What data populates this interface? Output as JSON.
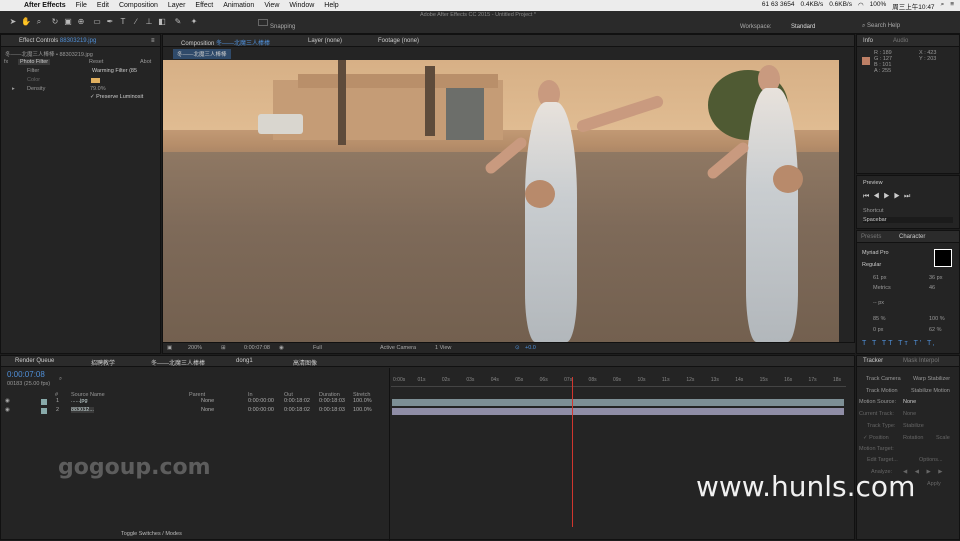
{
  "menubar": {
    "app": "After Effects",
    "items": [
      "File",
      "Edit",
      "Composition",
      "Layer",
      "Effect",
      "Animation",
      "View",
      "Window",
      "Help"
    ],
    "status": {
      "network": "61 63 3654",
      "speed_up": "0.4KB/s",
      "speed_down": "0.6KB/s",
      "battery": "100%",
      "time": "周三上午10:47"
    }
  },
  "toolbar": {
    "snapping": "Snapping",
    "title": "Adobe After Effects CC 2015 - Untitled Project *",
    "workspace_label": "Workspace:",
    "workspace": "Standard",
    "search": "Search Help"
  },
  "effect_controls": {
    "tab": "Effect Controls",
    "file": "88303219.jpg",
    "breadcrumb": "冬——北魔三人棒棒 • 88303219.jpg",
    "effect": "Photo Filter",
    "reset": "Reset",
    "about": "Abot",
    "rows": [
      {
        "name": "Filter",
        "value": "Warming Filter (85"
      },
      {
        "name": "Color",
        "value": ""
      },
      {
        "name": "Density",
        "value": "79.0%"
      },
      {
        "name": "",
        "value": "Preserve Luminosit"
      }
    ]
  },
  "comp": {
    "tab": "Composition",
    "comp_name": "冬——北魔三人棒棒",
    "layer_tab": "Layer (none)",
    "footage_tab": "Footage (none)",
    "sub_tab": "冬——北魔三人棒棒",
    "zoom": "200%",
    "timecode": "0:00:07:08",
    "resolution": "Full",
    "camera": "Active Camera",
    "view": "1 View",
    "exposure": "+0.0"
  },
  "info": {
    "tab": "Info",
    "tab2": "Audio",
    "r": "R : 189",
    "g": "G : 127",
    "b": "B : 101",
    "a": "A : 255",
    "x": "X : 423",
    "y": "Y : 203"
  },
  "preview": {
    "title": "Preview",
    "shortcut_label": "Shortcut",
    "shortcut": "Spacebar"
  },
  "character": {
    "tab1": "Presets",
    "tab2": "Character",
    "font": "Myriad Pro",
    "style": "Regular",
    "size": "61 px",
    "leading": "36 px",
    "kerning": "Metrics",
    "tracking": "46",
    "px": "-- px",
    "vscale": "85 %",
    "hscale": "100 %",
    "baseline": "0 px",
    "tsume": "62 %"
  },
  "tracker": {
    "tab1": "Tracker",
    "tab2": "Mask Interpol",
    "track_camera": "Track Camera",
    "warp": "Warp Stabilizer",
    "track_motion": "Track Motion",
    "stabilize": "Stabilize Motion",
    "motion_source": "Motion Source:",
    "motion_source_val": "None",
    "current_track": "Current Track:",
    "current_track_val": "None",
    "track_type": "Track Type:",
    "track_type_val": "Stabilize",
    "position": "Position",
    "rotation": "Rotation",
    "scale": "Scale",
    "motion_target": "Motion Target:",
    "edit_target": "Edit Target...",
    "options": "Options...",
    "analyze": "Analyze:",
    "apply": "Apply"
  },
  "timeline": {
    "tabs": [
      "Render Queue",
      "招聘教学",
      "冬——北魔三人棒棒",
      "dong1",
      "高清图像"
    ],
    "timecode": "0:00:07:08",
    "frames": "00183 (25.00 fps)",
    "cols": [
      "#",
      "Source Name",
      "Parent",
      "In",
      "Out",
      "Duration",
      "Stretch"
    ],
    "layers": [
      {
        "num": "1",
        "name": "......jpg",
        "parent": "None",
        "in": "0:00:00:00",
        "out": "0:00:18:02",
        "dur": "0:00:18:03",
        "stretch": "100.0%"
      },
      {
        "num": "2",
        "name": "883032...",
        "parent": "None",
        "in": "0:00:00:00",
        "out": "0:00:18:02",
        "dur": "0:00:18:03",
        "stretch": "100.0%"
      }
    ],
    "ticks": [
      "0:00s",
      "01s",
      "02s",
      "03s",
      "04s",
      "05s",
      "06s",
      "07s",
      "08s",
      "09s",
      "10s",
      "11s",
      "12s",
      "13s",
      "14s",
      "15s",
      "16s",
      "17s",
      "18s"
    ],
    "toggle": "Toggle Switches / Modes"
  },
  "watermarks": {
    "left": "gogoup.com",
    "right": "www.hunls.com"
  }
}
